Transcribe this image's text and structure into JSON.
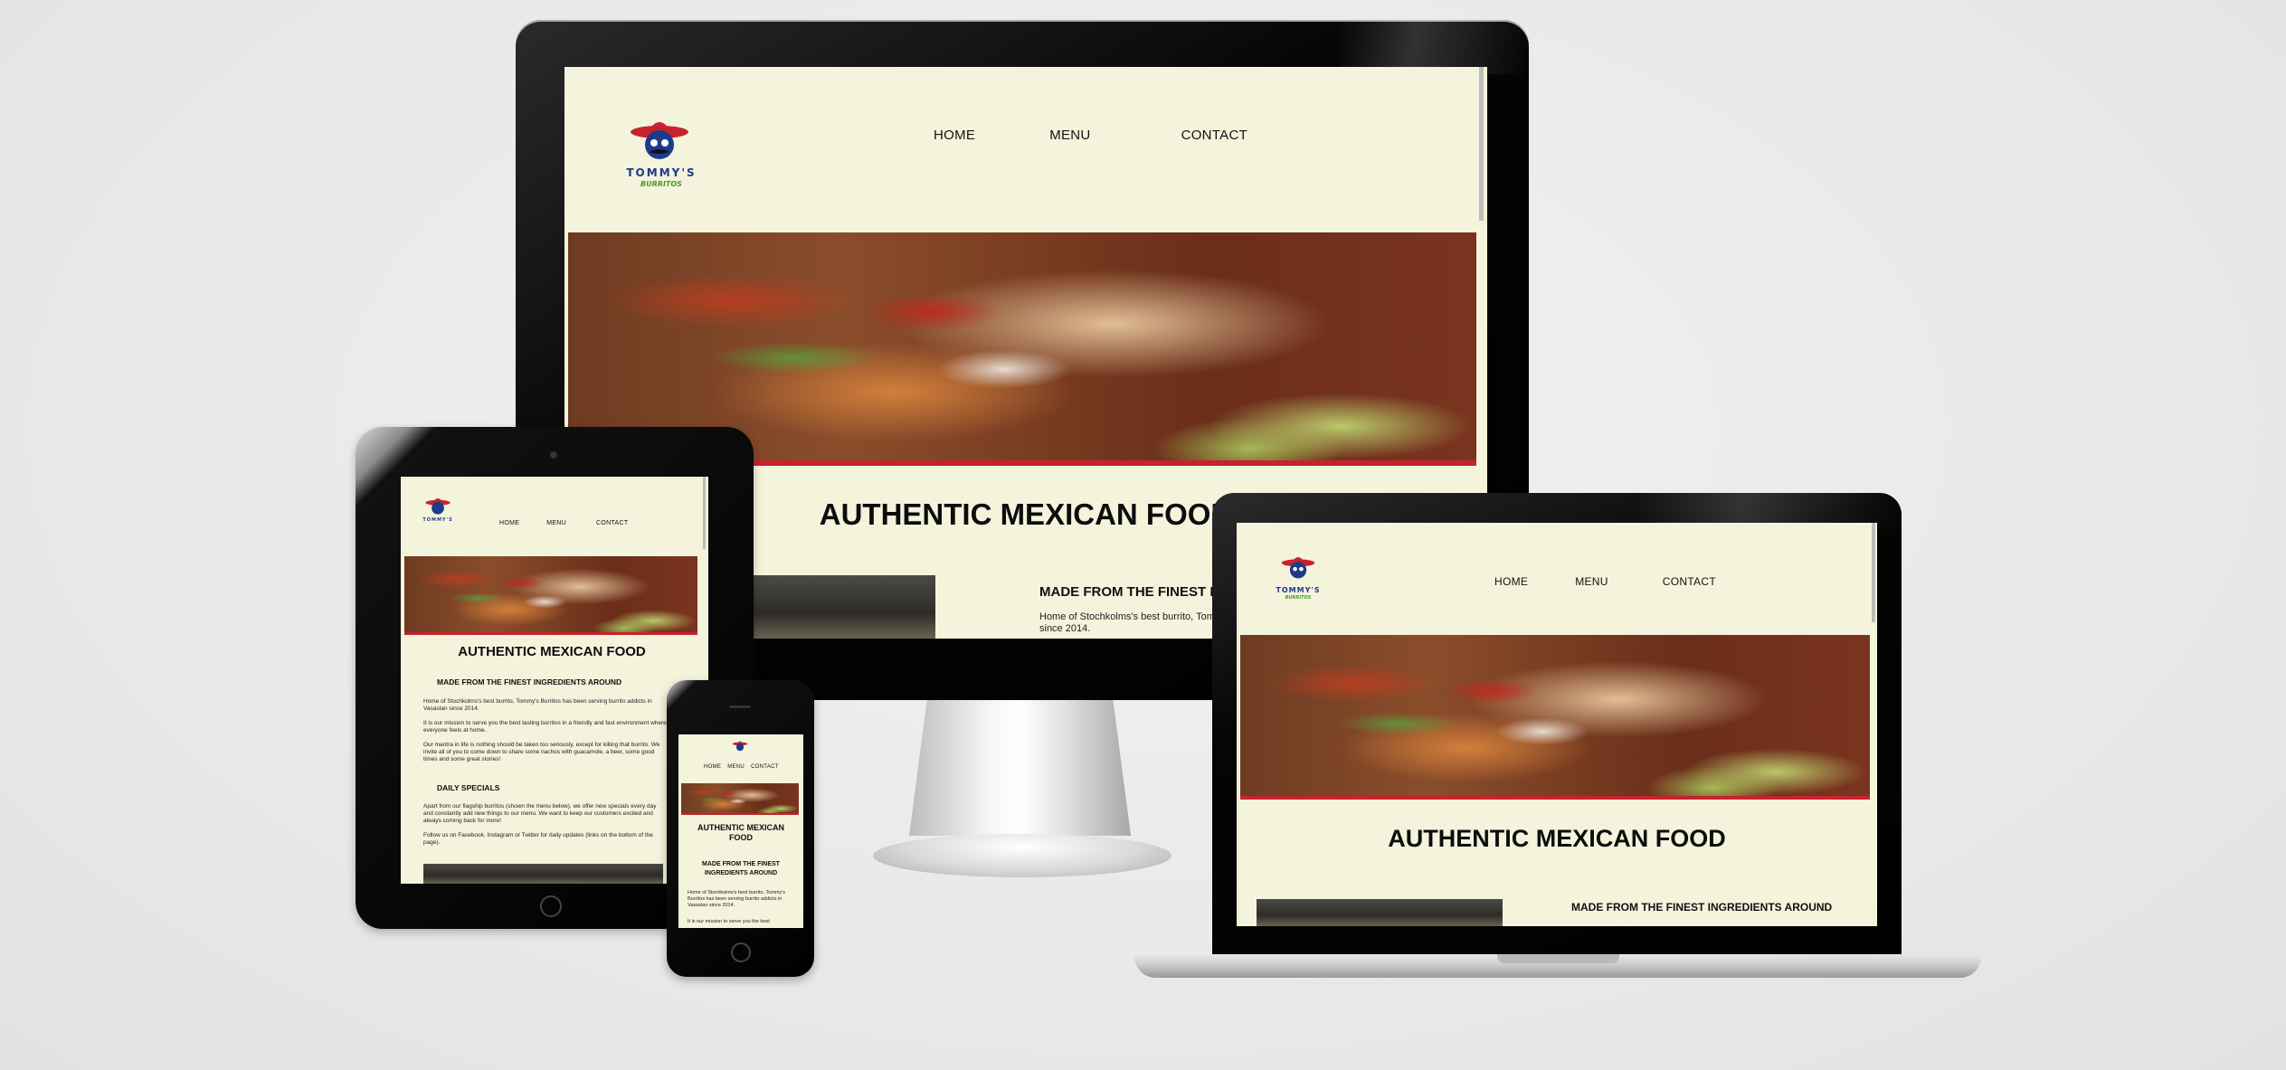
{
  "site": {
    "logo_text": "TOMMY'S",
    "logo_sub": "BURRITOS",
    "nav": [
      "HOME",
      "MENU",
      "CONTACT"
    ],
    "headline": "AUTHENTIC MEXICAN FOOD",
    "section_title": "MADE FROM THE FINEST INGREDIENTS AROUND",
    "section_title_cut": "MADE FROM THE FINEST INGRE",
    "mobile_headline_1": "AUTHENTIC MEXICAN",
    "mobile_headline_2": "FOOD",
    "mobile_section_1": "MADE FROM THE FINEST",
    "mobile_section_2": "INGREDIENTS AROUND",
    "desktop_intro_cut": "Home of Stochkolms's best burrito, Tommy",
    "desktop_intro_cut2": "since 2014.",
    "intro": "Home of Stochkolms's best burrito, Tommy's Burritos has been serving burrito addicts in Vasastan since 2014.",
    "mission": "It is our mission to serve you the best tasting burritos in a friendly and fast environment where everyone feels at home.",
    "mantra": "Our mantra in life is nothing should be taken too seriously, except for killing that burrito. We invite all of you to come down to share some nachos with guacamole, a beer, some good times and some great stories!",
    "specials_title": "DAILY SPECIALS",
    "specials": "Apart from our flagship burritos (shown the menu below), we offer new specials every day and constantly add new things to our menu. We want to keep our customers excited and always coming back for more!",
    "follow": "Follow us on Facebook, Instagram or Twitter for daily updates (links on the bottom of the page).",
    "mobile_intro": "Home of Stochkolms's best burrito, Tommy's Burritos has been serving burrito addicts in Vasastan since 2014.",
    "mobile_mission_cut": "It is our mission to serve you the best"
  },
  "colors": {
    "page_bg": "#f4f3dc",
    "accent_red": "#c7232e",
    "logo_blue": "#1d3a8a",
    "logo_green": "#4a9a2e"
  }
}
